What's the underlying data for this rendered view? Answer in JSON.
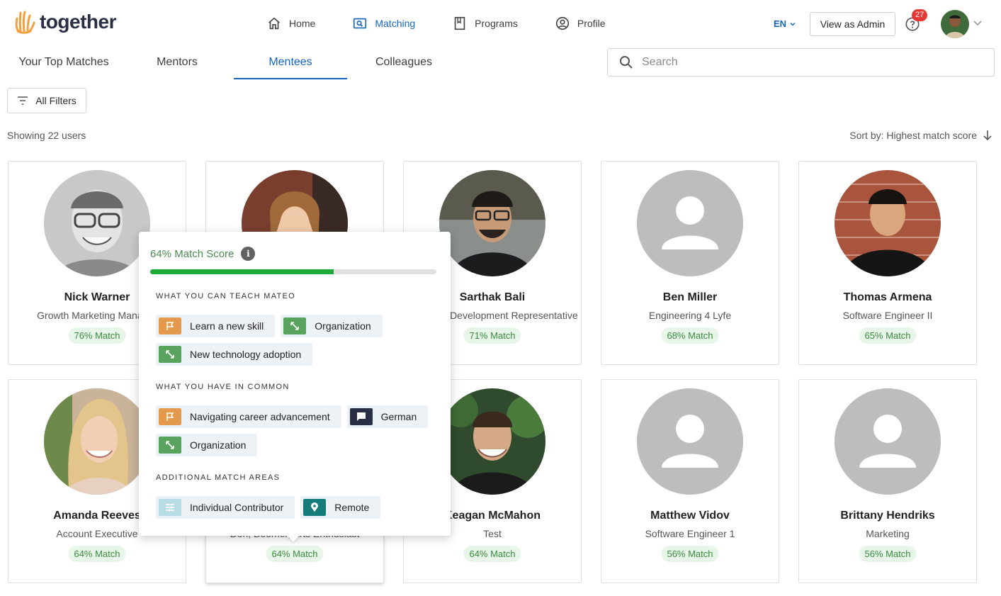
{
  "brand": {
    "name": "together"
  },
  "nav": [
    {
      "label": "Home",
      "icon": "home-icon"
    },
    {
      "label": "Matching",
      "icon": "matching-icon",
      "active": true
    },
    {
      "label": "Programs",
      "icon": "book-icon"
    },
    {
      "label": "Profile",
      "icon": "profile-icon"
    }
  ],
  "header": {
    "lang": "EN",
    "view_as_admin": "View as Admin",
    "notifications": "27"
  },
  "tabs": [
    {
      "label": "Your Top Matches"
    },
    {
      "label": "Mentors"
    },
    {
      "label": "Mentees",
      "active": true
    },
    {
      "label": "Colleagues"
    }
  ],
  "search": {
    "placeholder": "Search",
    "value": ""
  },
  "filters": {
    "label": "All Filters"
  },
  "results": {
    "showing": "Showing 22 users",
    "sort": "Sort by: Highest match score"
  },
  "users": [
    {
      "name": "Nick Warner",
      "role": "Growth Marketing Manager",
      "match": "76% Match"
    },
    {
      "name": "",
      "role": "",
      "match": ""
    },
    {
      "name": "Sarthak Bali",
      "role": "Business Development Representative",
      "match": "71% Match"
    },
    {
      "name": "Ben Miller",
      "role": "Engineering 4 Lyfe",
      "match": "68% Match"
    },
    {
      "name": "Thomas Armena",
      "role": "Software Engineer II",
      "match": "65% Match"
    },
    {
      "name": "Amanda Reeves",
      "role": "Account Executive",
      "match": "64% Match"
    },
    {
      "name": "",
      "role": "Don, Boomer, Arts Enthusiast",
      "match": "64% Match"
    },
    {
      "name": "Keagan McMahon",
      "role": "Test",
      "match": "64% Match"
    },
    {
      "name": "Matthew Vidov",
      "role": "Software Engineer 1",
      "match": "56% Match"
    },
    {
      "name": "Brittany Hendriks",
      "role": "Marketing",
      "match": "56% Match"
    }
  ],
  "popover": {
    "title": "64% Match Score",
    "score": 64,
    "sections": [
      {
        "heading": "WHAT YOU CAN TEACH MATEO",
        "chips": [
          {
            "label": "Learn a new skill",
            "icon": "flag-icon",
            "color": "#e49a4c"
          },
          {
            "label": "Organization",
            "icon": "expand-icon",
            "color": "#59a45d"
          },
          {
            "label": "New technology adoption",
            "icon": "expand-icon",
            "color": "#59a45d"
          }
        ]
      },
      {
        "heading": "WHAT YOU HAVE IN COMMON",
        "chips": [
          {
            "label": "Navigating career advancement",
            "icon": "flag-icon",
            "color": "#e49a4c"
          },
          {
            "label": "German",
            "icon": "chat-icon",
            "color": "#2a2f45"
          },
          {
            "label": "Organization",
            "icon": "expand-icon",
            "color": "#59a45d"
          }
        ]
      },
      {
        "heading": "ADDITIONAL MATCH AREAS",
        "chips": [
          {
            "label": "Individual Contributor",
            "icon": "sliders-icon",
            "color": "#b7dce3"
          },
          {
            "label": "Remote",
            "icon": "location-pin-icon",
            "color": "#157c7a"
          }
        ]
      }
    ]
  }
}
